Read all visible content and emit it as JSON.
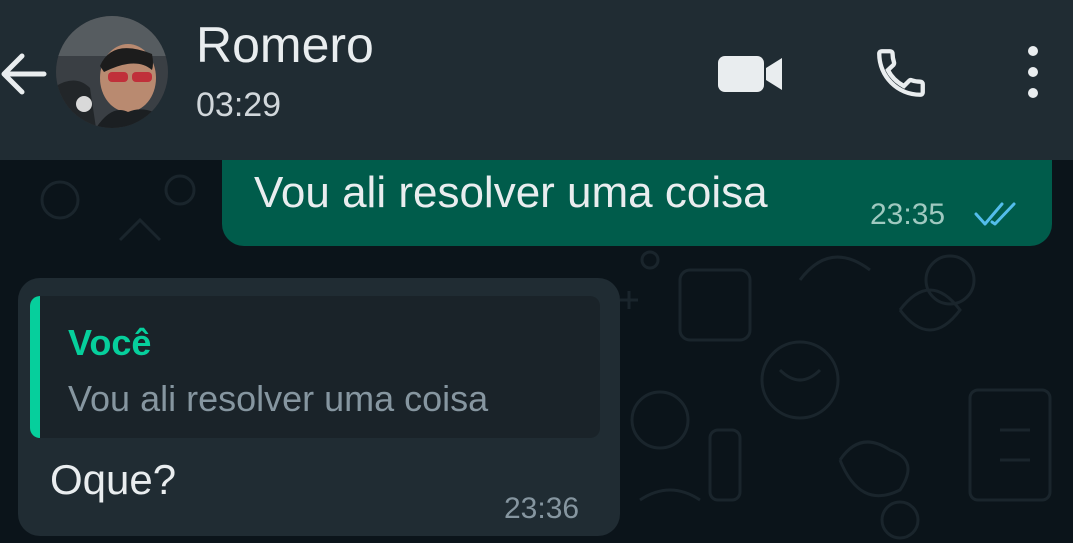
{
  "header": {
    "contact_name": "Romero",
    "last_seen": "03:29",
    "icons": [
      "back-arrow-icon",
      "avatar",
      "video-call-icon",
      "phone-icon",
      "more-vert-icon"
    ]
  },
  "messages": [
    {
      "direction": "outgoing",
      "text": "Vou ali resolver uma coisa",
      "time": "23:35",
      "status": "read-double-check"
    },
    {
      "direction": "incoming",
      "quote": {
        "author": "Você",
        "text": "Vou ali resolver uma coisa"
      },
      "text": "Oque?",
      "time": "23:36"
    }
  ],
  "colors": {
    "header_bg": "#202c33",
    "chat_bg": "#0b141a",
    "outgoing_bubble": "#005c4b",
    "incoming_bubble": "#202c33",
    "accent": "#06cf9c",
    "read_ticks": "#53bdeb"
  }
}
